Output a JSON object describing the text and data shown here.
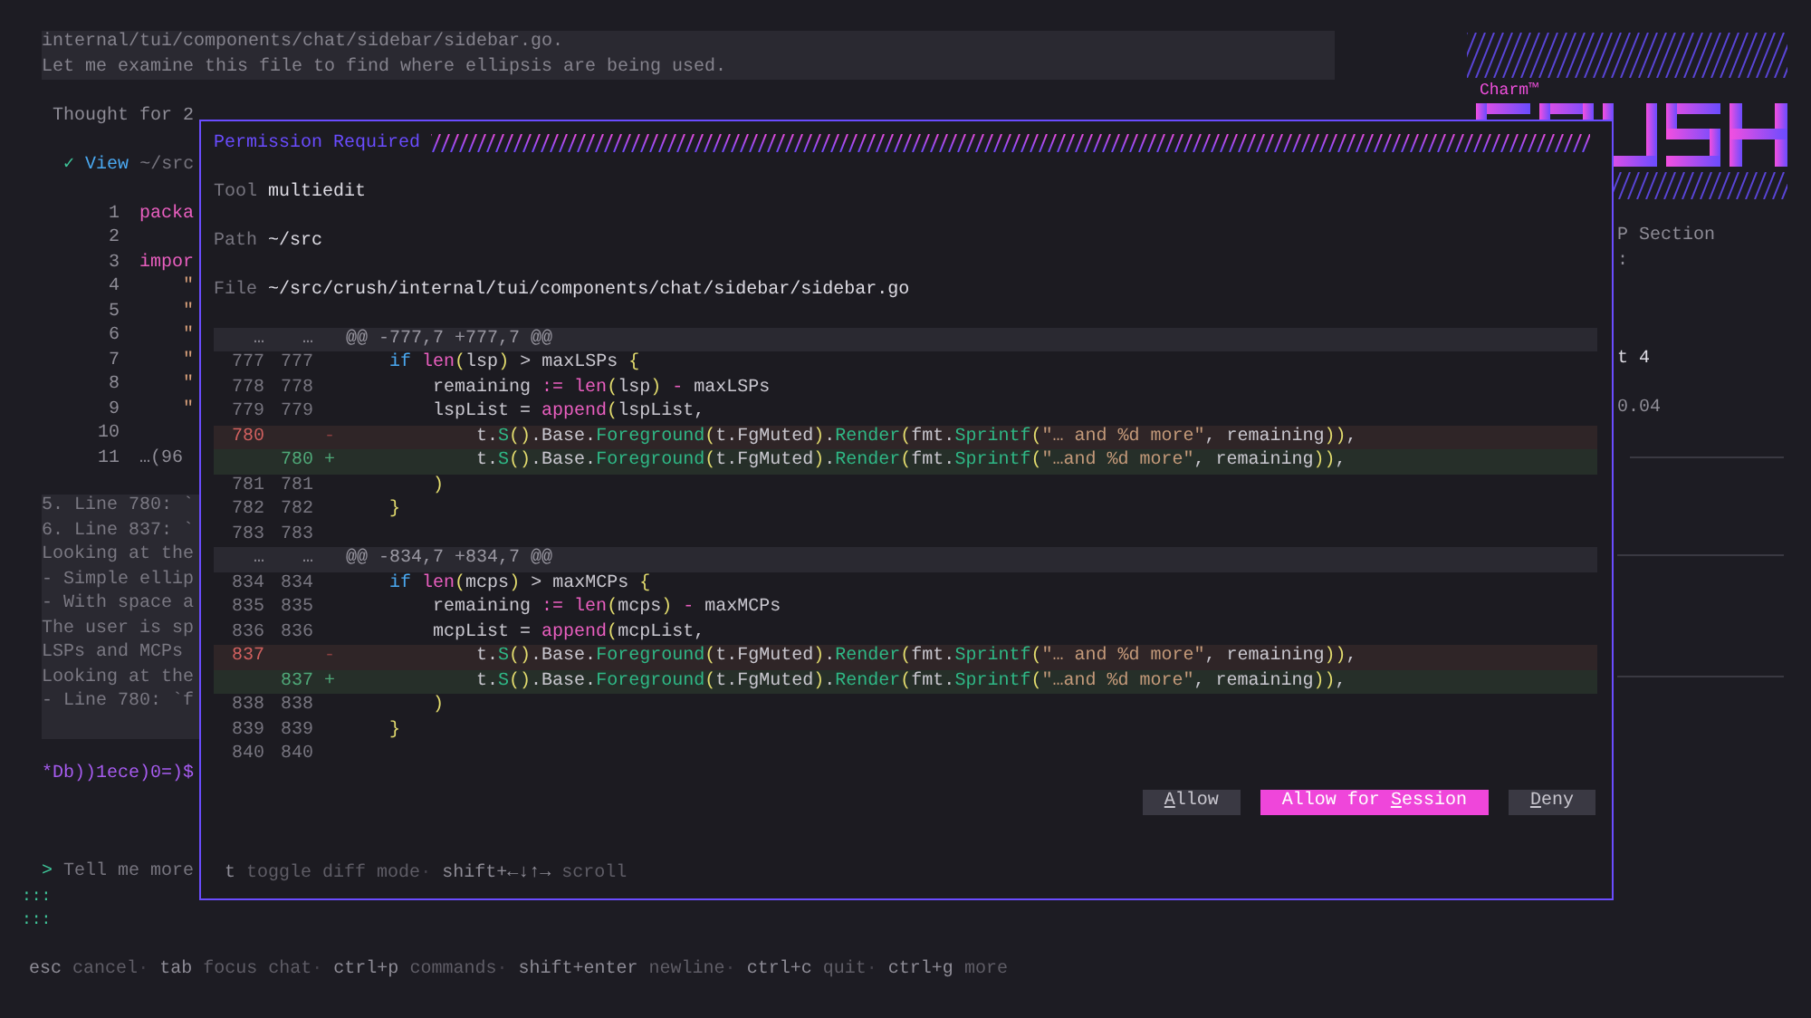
{
  "chat": {
    "message_box": [
      "internal/tui/components/chat/sidebar/sidebar.go.",
      "Let me examine this file to find where ellipsis are being used."
    ],
    "thought": "Thought for 2",
    "tool_call": {
      "status": "✓",
      "name": "View",
      "path": "~/src"
    },
    "code_preview": [
      {
        "number": "1",
        "text": "packa",
        "kind": "keyword"
      },
      {
        "number": "2"
      },
      {
        "number": "3",
        "text": "impor",
        "kind": "keyword"
      },
      {
        "number": "4",
        "text": "    \"",
        "kind": "string"
      },
      {
        "number": "5",
        "text": "    \"",
        "kind": "string"
      },
      {
        "number": "6",
        "text": "    \"",
        "kind": "string"
      },
      {
        "number": "7",
        "text": "    \"",
        "kind": "string"
      },
      {
        "number": "8",
        "text": "    \"",
        "kind": "string"
      },
      {
        "number": "9",
        "text": "    \"",
        "kind": "string"
      },
      {
        "number": "10"
      },
      {
        "number": "11",
        "text": "…(96",
        "kind": "plain"
      }
    ],
    "reasoning_box": [
      "5. Line 780: `",
      "6. Line 837: `",
      "Looking at the",
      "- Simple ellip",
      "- With space a",
      "The user is sp",
      "LSPs and MCPs",
      "Looking at the",
      "- Line 780: `f"
    ],
    "spinner": "*Db))1ece)0=)$",
    "prompt": {
      "symbol": ">",
      "hint": "Tell me more"
    },
    "gutter_marks": [
      ":::",
      ":::"
    ],
    "help": [
      {
        "key": "esc",
        "action": "cancel"
      },
      {
        "separator": "·",
        "key": "tab",
        "action": "focus chat"
      },
      {
        "separator": "·",
        "key": "ctrl+p",
        "action": "commands"
      },
      {
        "separator": "·",
        "key": "shift+enter",
        "action": "newline"
      },
      {
        "separator": "·",
        "key": "ctrl+c",
        "action": "quit"
      },
      {
        "separator": "·",
        "key": "ctrl+g",
        "action": "more"
      }
    ]
  },
  "sidebar": {
    "brand": "Charm™",
    "lines": [
      {
        "text": "P Section",
        "kind": "muted"
      },
      {
        "text": ":",
        "kind": "muted"
      },
      {
        "text": "t 4",
        "kind": "bright"
      },
      {
        "text": "0.04",
        "kind": "muted"
      }
    ]
  },
  "dialog": {
    "title": "Permission Required",
    "fields": [
      {
        "label": "Tool",
        "value": "multiedit"
      },
      {
        "label": "Path",
        "value": "~/src"
      },
      {
        "label": "File",
        "value": "~/src/crush/internal/tui/components/chat/sidebar/sidebar.go"
      }
    ],
    "diff": [
      {
        "kind": "hunk",
        "old": "…",
        "new": "…",
        "text": "@@ -777,7 +777,7 @@"
      },
      {
        "kind": "context",
        "old": "777",
        "new": "777",
        "tokens": [
          {
            "kind": "keyword",
            "text": "    if"
          },
          {
            "kind": "builtin",
            "text": " len"
          },
          {
            "kind": "paren",
            "text": "("
          },
          {
            "kind": "plain",
            "text": "lsp"
          },
          {
            "kind": "paren",
            "text": ")"
          },
          {
            "kind": "plain",
            "text": " > maxLSPs "
          },
          {
            "kind": "paren",
            "text": "{"
          }
        ]
      },
      {
        "kind": "context",
        "old": "778",
        "new": "778",
        "tokens": [
          {
            "kind": "plain",
            "text": "        remaining "
          },
          {
            "kind": "builtin",
            "text": ":="
          },
          {
            "kind": "builtin",
            "text": " len"
          },
          {
            "kind": "paren",
            "text": "("
          },
          {
            "kind": "plain",
            "text": "lsp"
          },
          {
            "kind": "paren",
            "text": ")"
          },
          {
            "kind": "builtin",
            "text": " - "
          },
          {
            "kind": "plain",
            "text": "maxLSPs"
          }
        ]
      },
      {
        "kind": "context",
        "old": "779",
        "new": "779",
        "tokens": [
          {
            "kind": "plain",
            "text": "        lspList = "
          },
          {
            "kind": "builtin",
            "text": "append"
          },
          {
            "kind": "paren",
            "text": "("
          },
          {
            "kind": "plain",
            "text": "lspList,"
          }
        ]
      },
      {
        "kind": "removed",
        "old": "780",
        "sign": "-",
        "tokens": [
          {
            "kind": "plain",
            "text": "            t."
          },
          {
            "kind": "func",
            "text": "S"
          },
          {
            "kind": "paren",
            "text": "()"
          },
          {
            "kind": "plain",
            "text": ".Base."
          },
          {
            "kind": "func",
            "text": "Foreground"
          },
          {
            "kind": "paren",
            "text": "("
          },
          {
            "kind": "plain",
            "text": "t.FgMuted"
          },
          {
            "kind": "paren",
            "text": ")"
          },
          {
            "kind": "plain",
            "text": "."
          },
          {
            "kind": "func",
            "text": "Render"
          },
          {
            "kind": "paren",
            "text": "("
          },
          {
            "kind": "plain",
            "text": "fmt."
          },
          {
            "kind": "func",
            "text": "Sprintf"
          },
          {
            "kind": "paren",
            "text": "("
          },
          {
            "kind": "string",
            "text": "\"… and %d more\""
          },
          {
            "kind": "plain",
            "text": ", remaining"
          },
          {
            "kind": "paren",
            "text": "))"
          },
          {
            "kind": "plain",
            "text": ","
          }
        ]
      },
      {
        "kind": "added",
        "new": "780",
        "sign": "+",
        "tokens": [
          {
            "kind": "plain",
            "text": "            t."
          },
          {
            "kind": "func",
            "text": "S"
          },
          {
            "kind": "paren",
            "text": "()"
          },
          {
            "kind": "plain",
            "text": ".Base."
          },
          {
            "kind": "func",
            "text": "Foreground"
          },
          {
            "kind": "paren",
            "text": "("
          },
          {
            "kind": "plain",
            "text": "t.FgMuted"
          },
          {
            "kind": "paren",
            "text": ")"
          },
          {
            "kind": "plain",
            "text": "."
          },
          {
            "kind": "func",
            "text": "Render"
          },
          {
            "kind": "paren",
            "text": "("
          },
          {
            "kind": "plain",
            "text": "fmt."
          },
          {
            "kind": "func",
            "text": "Sprintf"
          },
          {
            "kind": "paren",
            "text": "("
          },
          {
            "kind": "string",
            "text": "\"…and %d more\""
          },
          {
            "kind": "plain",
            "text": ", remaining"
          },
          {
            "kind": "paren",
            "text": "))"
          },
          {
            "kind": "plain",
            "text": ","
          }
        ]
      },
      {
        "kind": "context",
        "old": "781",
        "new": "781",
        "tokens": [
          {
            "kind": "paren",
            "text": "        )"
          }
        ]
      },
      {
        "kind": "context",
        "old": "782",
        "new": "782",
        "tokens": [
          {
            "kind": "paren",
            "text": "    }"
          }
        ]
      },
      {
        "kind": "context",
        "old": "783",
        "new": "783"
      },
      {
        "kind": "hunk",
        "old": "…",
        "new": "…",
        "text": "@@ -834,7 +834,7 @@"
      },
      {
        "kind": "context",
        "old": "834",
        "new": "834",
        "tokens": [
          {
            "kind": "keyword",
            "text": "    if"
          },
          {
            "kind": "builtin",
            "text": " len"
          },
          {
            "kind": "paren",
            "text": "("
          },
          {
            "kind": "plain",
            "text": "mcps"
          },
          {
            "kind": "paren",
            "text": ")"
          },
          {
            "kind": "plain",
            "text": " > maxMCPs "
          },
          {
            "kind": "paren",
            "text": "{"
          }
        ]
      },
      {
        "kind": "context",
        "old": "835",
        "new": "835",
        "tokens": [
          {
            "kind": "plain",
            "text": "        remaining "
          },
          {
            "kind": "builtin",
            "text": ":="
          },
          {
            "kind": "builtin",
            "text": " len"
          },
          {
            "kind": "paren",
            "text": "("
          },
          {
            "kind": "plain",
            "text": "mcps"
          },
          {
            "kind": "paren",
            "text": ")"
          },
          {
            "kind": "builtin",
            "text": " - "
          },
          {
            "kind": "plain",
            "text": "maxMCPs"
          }
        ]
      },
      {
        "kind": "context",
        "old": "836",
        "new": "836",
        "tokens": [
          {
            "kind": "plain",
            "text": "        mcpList = "
          },
          {
            "kind": "builtin",
            "text": "append"
          },
          {
            "kind": "paren",
            "text": "("
          },
          {
            "kind": "plain",
            "text": "mcpList,"
          }
        ]
      },
      {
        "kind": "removed",
        "old": "837",
        "sign": "-",
        "tokens": [
          {
            "kind": "plain",
            "text": "            t."
          },
          {
            "kind": "func",
            "text": "S"
          },
          {
            "kind": "paren",
            "text": "()"
          },
          {
            "kind": "plain",
            "text": ".Base."
          },
          {
            "kind": "func",
            "text": "Foreground"
          },
          {
            "kind": "paren",
            "text": "("
          },
          {
            "kind": "plain",
            "text": "t.FgMuted"
          },
          {
            "kind": "paren",
            "text": ")"
          },
          {
            "kind": "plain",
            "text": "."
          },
          {
            "kind": "func",
            "text": "Render"
          },
          {
            "kind": "paren",
            "text": "("
          },
          {
            "kind": "plain",
            "text": "fmt."
          },
          {
            "kind": "func",
            "text": "Sprintf"
          },
          {
            "kind": "paren",
            "text": "("
          },
          {
            "kind": "string",
            "text": "\"… and %d more\""
          },
          {
            "kind": "plain",
            "text": ", remaining"
          },
          {
            "kind": "paren",
            "text": "))"
          },
          {
            "kind": "plain",
            "text": ","
          }
        ]
      },
      {
        "kind": "added",
        "new": "837",
        "sign": "+",
        "tokens": [
          {
            "kind": "plain",
            "text": "            t."
          },
          {
            "kind": "func",
            "text": "S"
          },
          {
            "kind": "paren",
            "text": "()"
          },
          {
            "kind": "plain",
            "text": ".Base."
          },
          {
            "kind": "func",
            "text": "Foreground"
          },
          {
            "kind": "paren",
            "text": "("
          },
          {
            "kind": "plain",
            "text": "t.FgMuted"
          },
          {
            "kind": "paren",
            "text": ")"
          },
          {
            "kind": "plain",
            "text": "."
          },
          {
            "kind": "func",
            "text": "Render"
          },
          {
            "kind": "paren",
            "text": "("
          },
          {
            "kind": "plain",
            "text": "fmt."
          },
          {
            "kind": "func",
            "text": "Sprintf"
          },
          {
            "kind": "paren",
            "text": "("
          },
          {
            "kind": "string",
            "text": "\"…and %d more\""
          },
          {
            "kind": "plain",
            "text": ", remaining"
          },
          {
            "kind": "paren",
            "text": "))"
          },
          {
            "kind": "plain",
            "text": ","
          }
        ]
      },
      {
        "kind": "context",
        "old": "838",
        "new": "838",
        "tokens": [
          {
            "kind": "paren",
            "text": "        )"
          }
        ]
      },
      {
        "kind": "context",
        "old": "839",
        "new": "839",
        "tokens": [
          {
            "kind": "paren",
            "text": "    }"
          }
        ]
      },
      {
        "kind": "context",
        "old": "840",
        "new": "840"
      }
    ],
    "buttons": [
      {
        "key": "A",
        "after": "llow",
        "selected": false
      },
      {
        "before": "Allow for ",
        "key": "S",
        "after": "ession",
        "selected": true
      },
      {
        "key": "D",
        "after": "eny",
        "selected": false
      }
    ],
    "help": [
      {
        "key": "t",
        "action": "toggle diff mode"
      },
      {
        "separator": "·",
        "key": "shift+←↓↑→",
        "action": "scroll"
      }
    ]
  }
}
